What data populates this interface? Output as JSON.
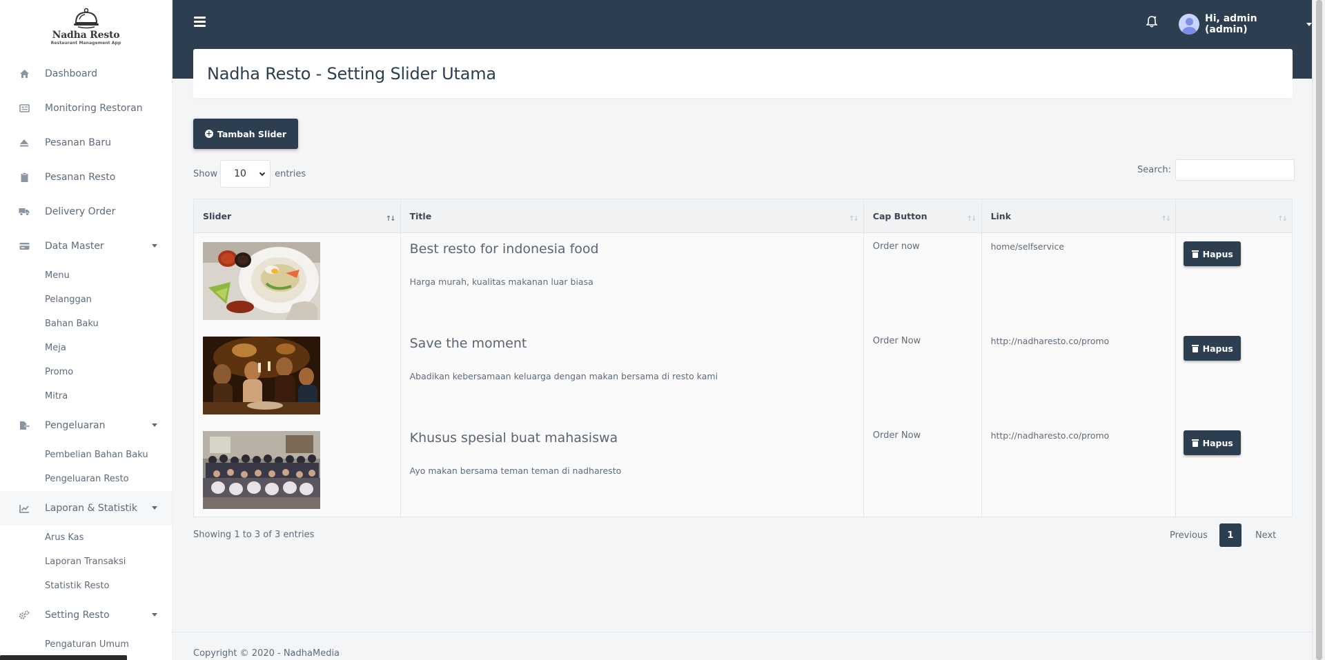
{
  "brand": {
    "name": "Nadha Resto",
    "tagline": "Restaurant Management App"
  },
  "sidebar": {
    "items": [
      {
        "label": "Dashboard",
        "icon": "home-icon"
      },
      {
        "label": "Monitoring Restoran",
        "icon": "monitor-icon"
      },
      {
        "label": "Pesanan Baru",
        "icon": "eject-icon"
      },
      {
        "label": "Pesanan Resto",
        "icon": "clipboard-icon"
      },
      {
        "label": "Delivery Order",
        "icon": "truck-icon"
      },
      {
        "label": "Data Master",
        "icon": "card-icon",
        "children": [
          "Menu",
          "Pelanggan",
          "Bahan Baku",
          "Meja",
          "Promo",
          "Mitra"
        ]
      },
      {
        "label": "Pengeluaran",
        "icon": "file-export-icon",
        "children": [
          "Pembelian Bahan Baku",
          "Pengeluaran Resto"
        ]
      },
      {
        "label": "Laporan & Statistik",
        "icon": "chart-line-icon",
        "children": [
          "Arus Kas",
          "Laporan Transaksi",
          "Statistik Resto"
        ]
      },
      {
        "label": "Setting Resto",
        "icon": "cogs-icon",
        "children": [
          "Pengaturan Umum"
        ]
      }
    ]
  },
  "topbar": {
    "user_label": "Hi, admin (admin)"
  },
  "page": {
    "title": "Nadha Resto - Setting Slider Utama",
    "add_button": "Tambah Slider"
  },
  "table_controls": {
    "show_label": "Show",
    "entries_value": "10",
    "entries_label": "entries",
    "search_label": "Search:"
  },
  "table": {
    "headers": [
      "Slider",
      "Title",
      "Cap Button",
      "Link",
      ""
    ],
    "rows": [
      {
        "title": "Best resto for indonesia food",
        "desc": "Harga murah, kualitas makanan luar biasa",
        "cap": "Order now",
        "link": "home/selfservice",
        "action": "Hapus",
        "image": "food-plate-photo"
      },
      {
        "title": "Save the moment",
        "desc": "Abadikan kebersamaan keluarga dengan makan bersama di resto kami",
        "cap": "Order Now",
        "link": "http://nadharesto.co/promo",
        "action": "Hapus",
        "image": "family-dinner-photo"
      },
      {
        "title": "Khusus spesial buat mahasiswa",
        "desc": "Ayo makan bersama teman teman di nadharesto",
        "cap": "Order Now",
        "link": "http://nadharesto.co/promo",
        "action": "Hapus",
        "image": "student-group-photo"
      }
    ]
  },
  "pagination": {
    "info": "Showing 1 to 3 of 3 entries",
    "previous": "Previous",
    "current": "1",
    "next": "Next"
  },
  "footer": {
    "text": "Copyright © 2020 - NadhaMedia"
  },
  "colors": {
    "primary": "#2c3e50",
    "background": "#f4f5f7"
  }
}
